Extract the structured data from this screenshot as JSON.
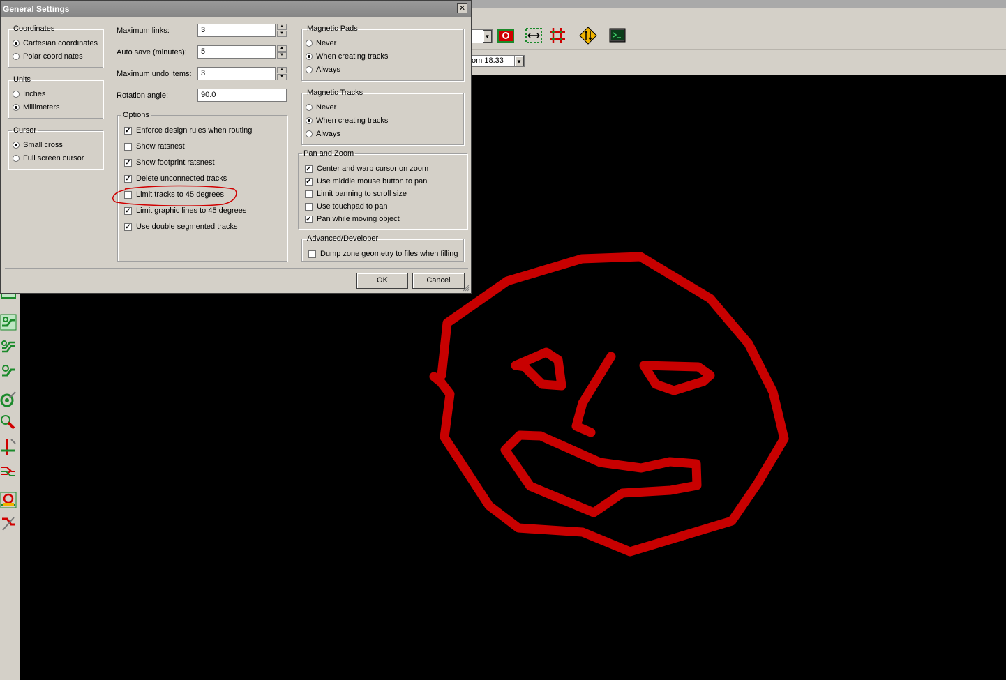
{
  "dialog": {
    "title": "General Settings",
    "close_glyph": "✕",
    "coordinates": {
      "label": "Coordinates",
      "options": [
        "Cartesian coordinates",
        "Polar coordinates"
      ],
      "selected": "Cartesian coordinates"
    },
    "units": {
      "label": "Units",
      "options": [
        "Inches",
        "Millimeters"
      ],
      "selected": "Millimeters"
    },
    "cursor": {
      "label": "Cursor",
      "options": [
        "Small cross",
        "Full screen cursor"
      ],
      "selected": "Small cross"
    },
    "fields": {
      "max_links_label": "Maximum links:",
      "max_links_value": "3",
      "auto_save_label": "Auto save (minutes):",
      "auto_save_value": "5",
      "max_undo_label": "Maximum undo items:",
      "max_undo_value": "3",
      "rotation_label": "Rotation angle:",
      "rotation_value": "90.0"
    },
    "options": {
      "label": "Options",
      "items": [
        {
          "label": "Enforce design rules when routing",
          "checked": true
        },
        {
          "label": "Show ratsnest",
          "checked": false
        },
        {
          "label": "Show footprint ratsnest",
          "checked": true
        },
        {
          "label": "Delete unconnected tracks",
          "checked": true
        },
        {
          "label": "Limit tracks to 45 degrees",
          "checked": false
        },
        {
          "label": "Limit graphic lines to 45 degrees",
          "checked": true
        },
        {
          "label": "Use double segmented tracks",
          "checked": true
        }
      ]
    },
    "magnetic_pads": {
      "label": "Magnetic Pads",
      "options": [
        "Never",
        "When creating tracks",
        "Always"
      ],
      "selected": "When creating tracks"
    },
    "magnetic_tracks": {
      "label": "Magnetic Tracks",
      "options": [
        "Never",
        "When creating tracks",
        "Always"
      ],
      "selected": "When creating tracks"
    },
    "pan_zoom": {
      "label": "Pan and Zoom",
      "items": [
        {
          "label": "Center and warp cursor on zoom",
          "checked": true
        },
        {
          "label": "Use middle mouse button to pan",
          "checked": true
        },
        {
          "label": "Limit panning to scroll size",
          "checked": false
        },
        {
          "label": "Use touchpad to pan",
          "checked": false
        },
        {
          "label": "Pan while moving object",
          "checked": true
        }
      ]
    },
    "advanced": {
      "label": "Advanced/Developer",
      "items": [
        {
          "label": "Dump zone geometry to files when filling",
          "checked": false
        }
      ]
    },
    "ok_label": "OK",
    "cancel_label": "Cancel"
  },
  "app": {
    "zoom_text": "om 18.33",
    "dropdown_glyph": "▼"
  },
  "colors": {
    "track": "#c80000",
    "dialog_bg": "#d4d0c8",
    "canvas_bg": "#000000"
  },
  "annotation": {
    "circled_item": "Limit tracks to 45 degrees"
  }
}
